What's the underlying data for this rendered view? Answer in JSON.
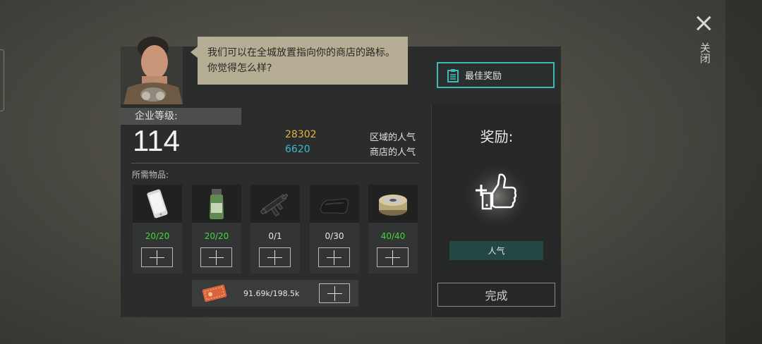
{
  "close": {
    "label": "关闭"
  },
  "speech": {
    "text": "我们可以在全城放置指向你的商店的路标。你觉得怎么样?"
  },
  "best_reward_button": {
    "label": "最佳奖励"
  },
  "level": {
    "label": "企业等级:",
    "value": "114"
  },
  "popularity": {
    "region": {
      "value": "28302",
      "label": "区域的人气",
      "color": "#e3b53a"
    },
    "shop": {
      "value": "6620",
      "label": "商店的人气",
      "color": "#3fb9c8"
    }
  },
  "required_label": "所需物品:",
  "items": [
    {
      "icon": "smartphone-icon",
      "count": "20/20",
      "complete": true
    },
    {
      "icon": "medicine-jar-icon",
      "count": "20/20",
      "complete": true
    },
    {
      "icon": "submachine-gun-icon",
      "count": "0/1",
      "complete": false
    },
    {
      "icon": "cloth-icon",
      "count": "0/30",
      "complete": false
    },
    {
      "icon": "wire-spool-icon",
      "count": "40/40",
      "complete": true
    }
  ],
  "currency": {
    "icon": "ticket-icon",
    "value": "91.69k/198.5k"
  },
  "reward": {
    "title": "奖励:",
    "icon": "thumbs-up-plus-icon",
    "tag": "人气"
  },
  "done_button": {
    "label": "完成"
  }
}
